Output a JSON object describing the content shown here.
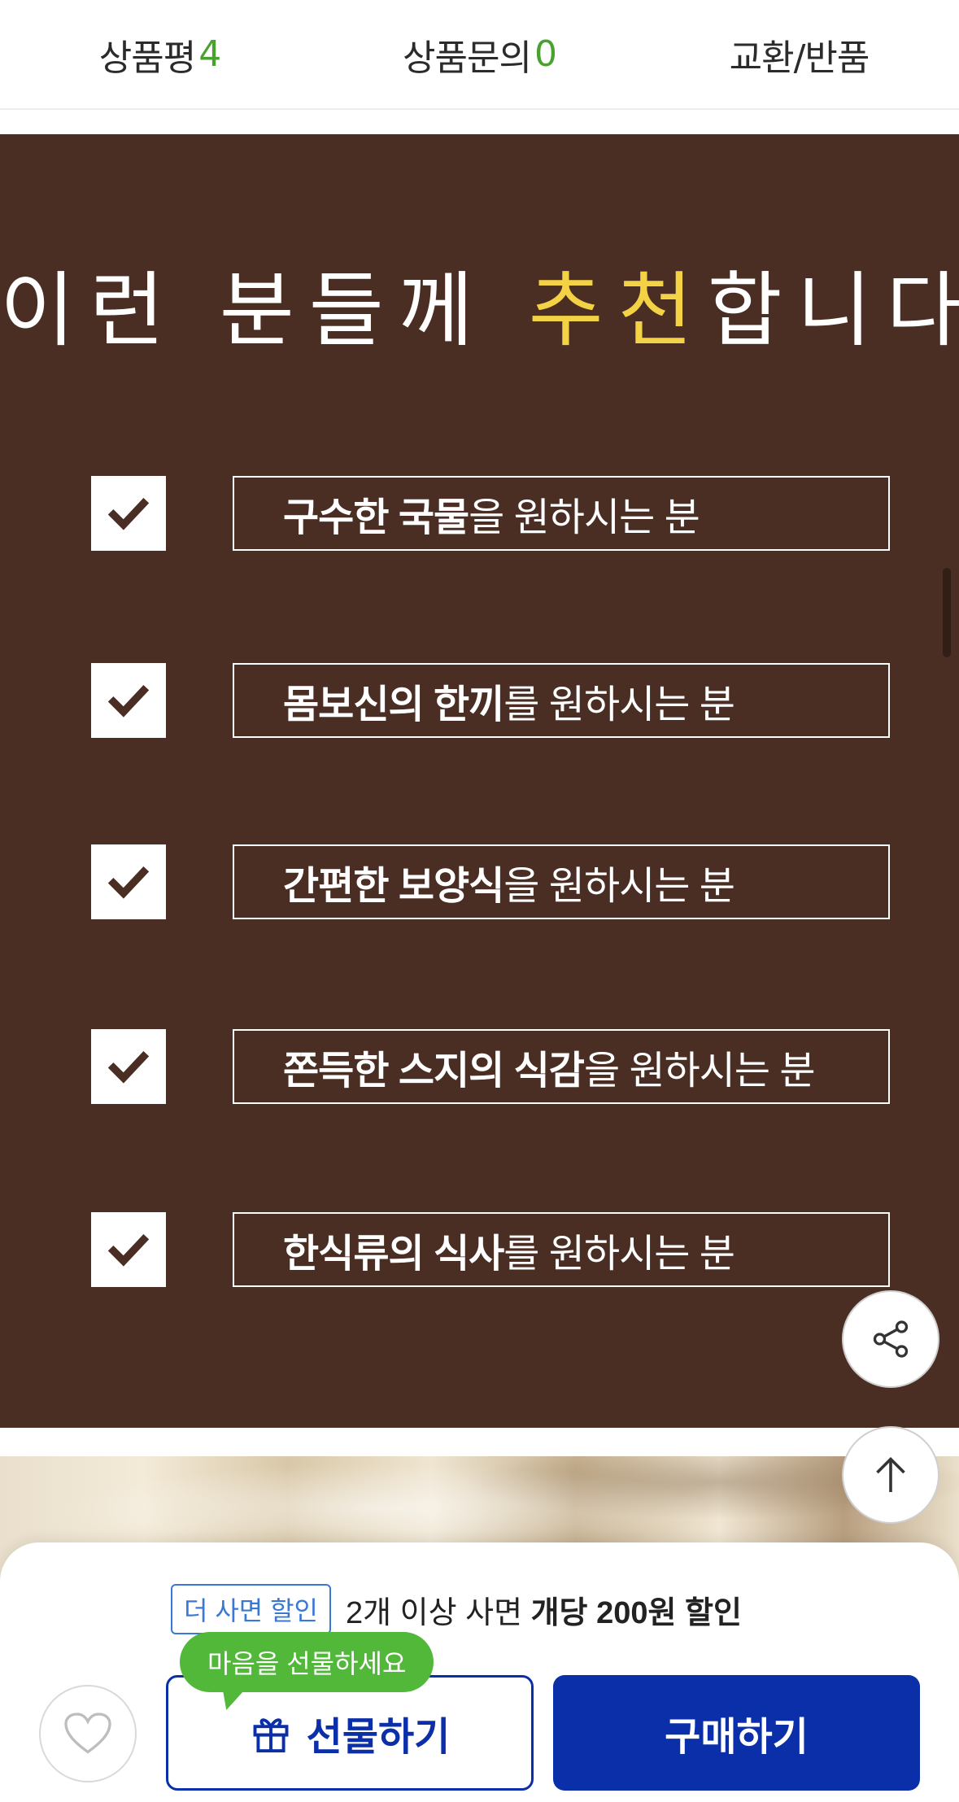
{
  "tabs": [
    {
      "label": "상품평",
      "count": "4"
    },
    {
      "label": "상품문의",
      "count": "0"
    },
    {
      "label": "교환/반품",
      "count": ""
    }
  ],
  "promo": {
    "headline_pre": "이런 분들께 ",
    "headline_accent": "추천",
    "headline_post": "합니다.",
    "items": [
      {
        "bold": "구수한 국물",
        "rest": "을 원하시는 분"
      },
      {
        "bold": "몸보신의 한끼",
        "rest": "를 원하시는 분"
      },
      {
        "bold": "간편한 보양식",
        "rest": "을 원하시는 분"
      },
      {
        "bold": "쫀득한 스지의 식감",
        "rest": "을 원하시는 분"
      },
      {
        "bold": "한식류의 식사",
        "rest": "를 원하시는 분"
      }
    ]
  },
  "floating": {
    "share_icon": "share-icon",
    "top_icon": "arrow-up-icon"
  },
  "bottom_bar": {
    "discount_tag": "더 사면 할인",
    "discount_text": "2개 이상 사면 ",
    "discount_bold": "개당 200원 할인",
    "tooltip": "마음을 선물하세요",
    "gift_label": "선물하기",
    "buy_label": "구매하기",
    "heart_icon": "heart-icon",
    "gift_icon": "gift-icon"
  },
  "colors": {
    "brown": "#4a2e23",
    "accent_yellow": "#f4d245",
    "green": "#49a12f",
    "brand_blue": "#0b2fa8",
    "tooltip_green": "#52b83a"
  }
}
